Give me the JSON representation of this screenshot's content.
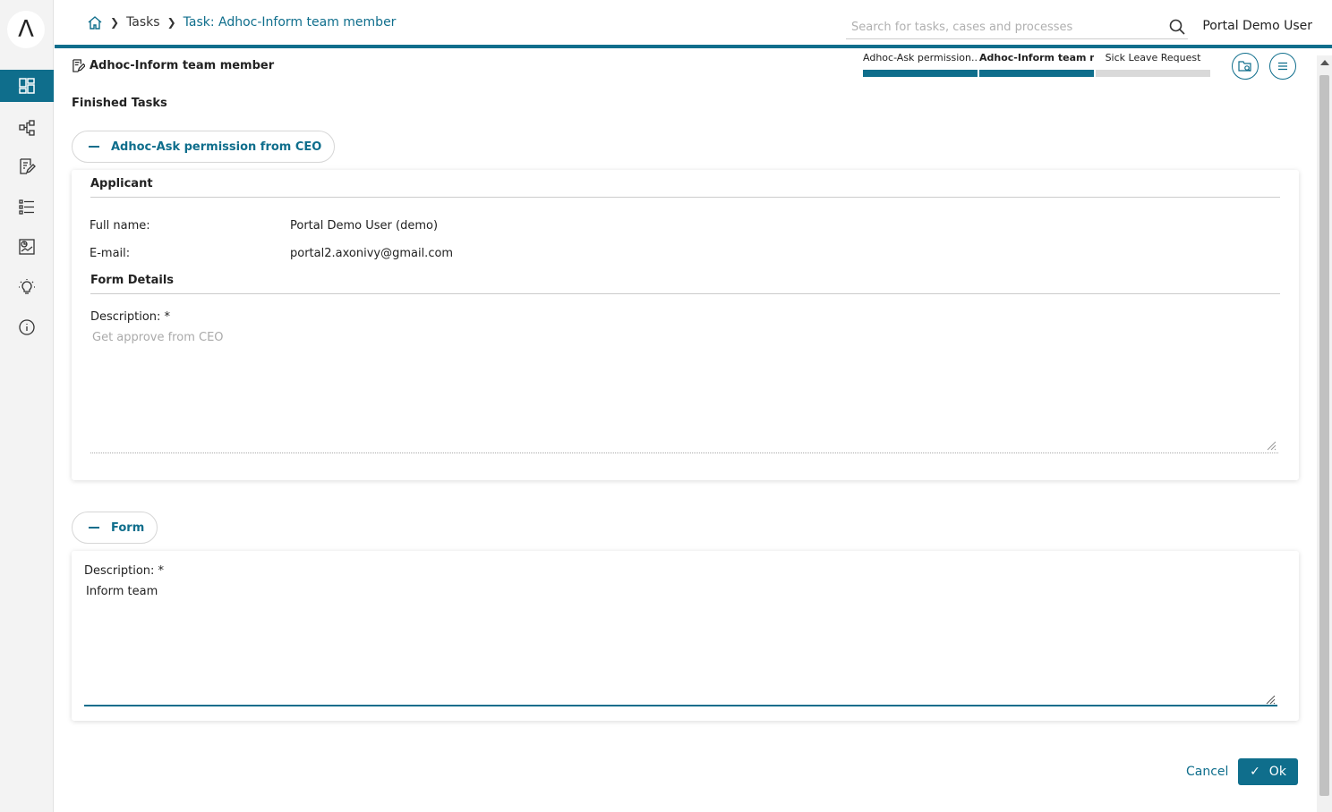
{
  "sidebar": {
    "logo": "Λ",
    "items": [
      {
        "icon": "dashboard-icon",
        "active": true
      },
      {
        "icon": "processes-icon"
      },
      {
        "icon": "tasks-icon"
      },
      {
        "icon": "cases-icon"
      },
      {
        "icon": "statistics-icon"
      },
      {
        "icon": "ideas-icon"
      },
      {
        "icon": "info-icon"
      }
    ]
  },
  "header": {
    "breadcrumb": {
      "home_icon": "home-icon",
      "tasks": "Tasks",
      "current": "Task: Adhoc-Inform team member"
    },
    "search_placeholder": "Search for tasks, cases and processes",
    "user": "Portal Demo User"
  },
  "task": {
    "title": "Adhoc-Inform team member",
    "steps": [
      {
        "label": "Adhoc-Ask permission...",
        "status": "done"
      },
      {
        "label": "Adhoc-Inform team m...",
        "status": "current"
      },
      {
        "label": "Sick Leave Request",
        "status": "pending"
      }
    ]
  },
  "finished": {
    "label": "Finished Tasks",
    "toggle": "Adhoc-Ask permission from CEO",
    "applicant_head": "Applicant",
    "fullname_label": "Full name:",
    "fullname_value": "Portal Demo User (demo)",
    "email_label": "E-mail:",
    "email_value": "portal2.axonivy@gmail.com",
    "form_details_head": "Form Details",
    "description_label": "Description:  *",
    "description_value": "Get approve from CEO"
  },
  "form": {
    "toggle": "Form",
    "description_label": "Description:  *",
    "description_value": "Inform team"
  },
  "actions": {
    "cancel": "Cancel",
    "ok": "Ok"
  },
  "colors": {
    "accent": "#0f6e8c"
  }
}
